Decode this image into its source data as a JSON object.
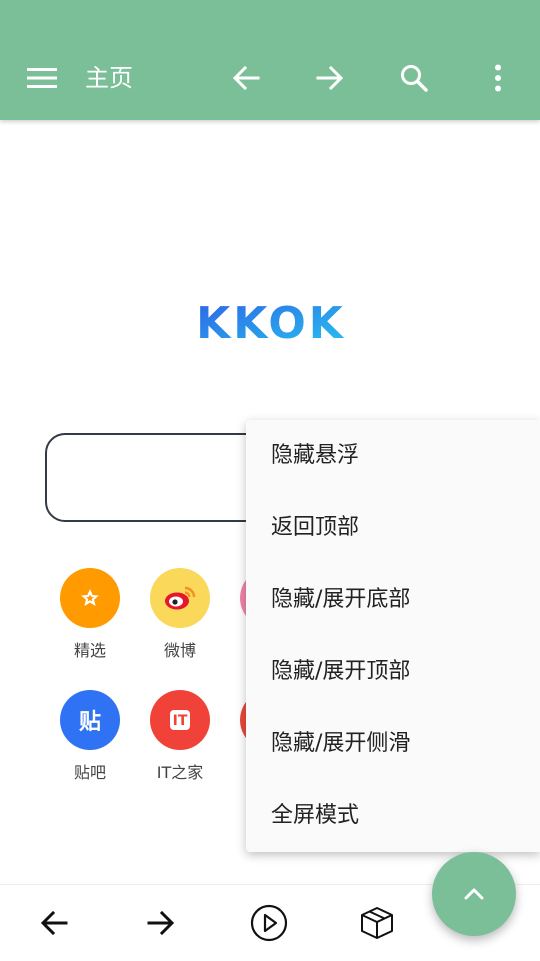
{
  "appbar": {
    "title": "主页",
    "icons": [
      "menu-icon",
      "back-arrow-icon",
      "forward-arrow-icon",
      "search-icon",
      "more-vert-icon"
    ],
    "color": "#7bbf99"
  },
  "logo": {
    "text": "KKOK",
    "gradient": [
      "#2d63e6",
      "#27c4ef"
    ]
  },
  "shortcuts": [
    {
      "label": "精选",
      "icon": "star-icon",
      "color": "#ff9a00"
    },
    {
      "label": "微博",
      "icon": "weibo-icon",
      "color": "#f9d85a"
    },
    {
      "label": "贴吧",
      "icon": "tieba-icon",
      "glyph": "贴",
      "color": "#2f72f4"
    },
    {
      "label": "IT之家",
      "icon": "ithome-icon",
      "glyph": "IT",
      "color": "#f1423a"
    }
  ],
  "menu": {
    "items": [
      "隐藏悬浮",
      "返回顶部",
      "隐藏/展开底部",
      "隐藏/展开顶部",
      "隐藏/展开侧滑",
      "全屏模式"
    ]
  },
  "bottombar": {
    "icons": [
      "back-arrow-icon",
      "forward-arrow-icon",
      "play-circle-icon",
      "box-icon"
    ]
  },
  "fab": {
    "icon": "chevron-up-icon",
    "color": "#7bbf99"
  }
}
